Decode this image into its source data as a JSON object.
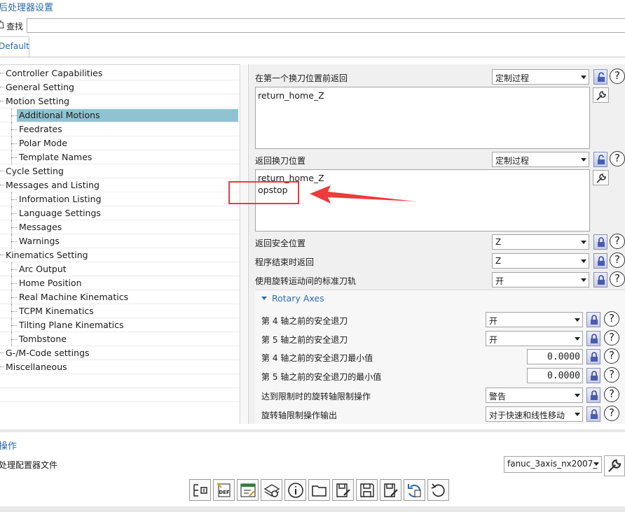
{
  "window": {
    "title": "后处理器设置"
  },
  "find": {
    "label": "查找",
    "value": ""
  },
  "tabs": [
    {
      "label": "Default"
    }
  ],
  "tree": {
    "items": [
      {
        "label": "Controller Capabilities",
        "level": 0
      },
      {
        "label": "General Setting",
        "level": 0
      },
      {
        "label": "Motion Setting",
        "level": 0
      },
      {
        "label": "Additional Motions",
        "level": 1,
        "selected": true
      },
      {
        "label": "Feedrates",
        "level": 1
      },
      {
        "label": "Polar Mode",
        "level": 1
      },
      {
        "label": "Template Names",
        "level": 1
      },
      {
        "label": "Cycle Setting",
        "level": 0
      },
      {
        "label": "Messages and Listing",
        "level": 0
      },
      {
        "label": "Information Listing",
        "level": 1
      },
      {
        "label": "Language Settings",
        "level": 1
      },
      {
        "label": "Messages",
        "level": 1
      },
      {
        "label": "Warnings",
        "level": 1
      },
      {
        "label": "Kinematics Setting",
        "level": 0
      },
      {
        "label": "Arc Output",
        "level": 1
      },
      {
        "label": "Home Position",
        "level": 1
      },
      {
        "label": "Real Machine Kinematics",
        "level": 1
      },
      {
        "label": "TCPM Kinematics",
        "level": 1
      },
      {
        "label": "Tilting Plane Kinematics",
        "level": 1
      },
      {
        "label": "Tombstone",
        "level": 1
      },
      {
        "label": "G-/M-Code settings",
        "level": 0
      },
      {
        "label": "Miscellaneous",
        "level": 0
      }
    ]
  },
  "settings": {
    "first_toolchange_return": {
      "label": "在第一个换刀位置前返回",
      "combo": "定制过程",
      "lines": [
        "return_home_Z"
      ]
    },
    "return_toolchange": {
      "label": "返回换刀位置",
      "combo": "定制过程",
      "lines": [
        "return_home_Z",
        "opstop"
      ]
    },
    "return_safe": {
      "label": "返回安全位置",
      "value": "Z"
    },
    "program_end_return": {
      "label": "程序结束时返回",
      "value": "Z"
    },
    "rotary_standard_path": {
      "label": "使用旋转运动间的标准刀轨",
      "value": "开"
    },
    "rotary_axes": {
      "title": "Rotary Axes",
      "axis4_retract": {
        "label": "第 4 轴之前的安全退刀",
        "value": "开"
      },
      "axis5_retract": {
        "label": "第 5 轴之前的安全退刀",
        "value": "开"
      },
      "axis4_min": {
        "label": "第 4 轴之前的安全退刀最小值",
        "value": "0.0000"
      },
      "axis5_min": {
        "label": "第 5 轴之前的安全退刀的最小值",
        "value": "0.0000"
      },
      "limit_action": {
        "label": "达到限制时的旋转轴限制操作",
        "value": "警告"
      },
      "limit_output": {
        "label": "旋转轴限制操作输出",
        "value": "对于快速和线性移动"
      }
    }
  },
  "operations": {
    "title": "操作",
    "config_label": "处理配置器文件",
    "config_value": "fanuc_3axis_nx2007_"
  },
  "toolbar_icons": [
    "export-icon",
    "definition-file-icon",
    "edit-settings-icon",
    "gears-settings-icon",
    "info-icon",
    "open-folder-icon",
    "save-as-icon",
    "save-icon",
    "edit-file-icon",
    "refresh-icon",
    "undo-icon"
  ],
  "colors": {
    "accent": "#2a6ab1",
    "selection": "#8fc3d2",
    "annotation": "#ee3b3b"
  }
}
